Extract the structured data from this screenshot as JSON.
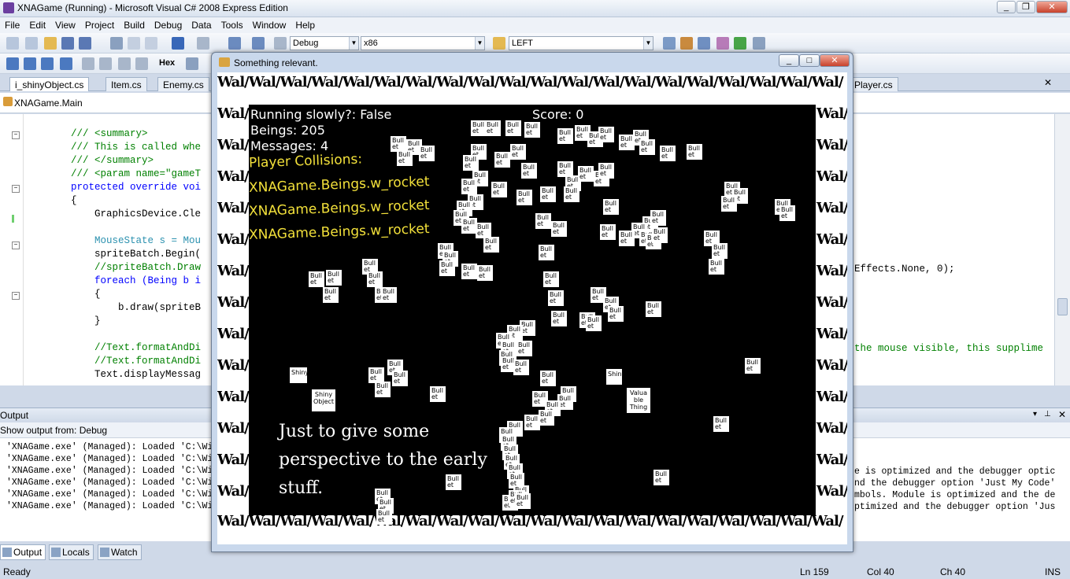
{
  "window": {
    "title": "XNAGame (Running) - Microsoft Visual C# 2008 Express Edition"
  },
  "menu": [
    "File",
    "Edit",
    "View",
    "Project",
    "Build",
    "Debug",
    "Data",
    "Tools",
    "Window",
    "Help"
  ],
  "toolbar": {
    "config": "Debug",
    "platform": "x86",
    "find": "LEFT",
    "hex": "Hex"
  },
  "tabs": [
    "i_shinyObject.cs",
    "Item.cs",
    "Enemy.cs",
    "Player.cs"
  ],
  "navbar": {
    "class": "XNAGame.Main"
  },
  "code_lines": [
    {
      "text": "        /// <summary>",
      "cls": "cm"
    },
    {
      "text": "        /// This is called whe",
      "cls": "cm"
    },
    {
      "text": "        /// </summary>",
      "cls": "cm"
    },
    {
      "text": "        /// <param name=\"gameT",
      "cls": "cm"
    },
    {
      "text": "        protected override voi",
      "cls": "kw"
    },
    {
      "text": "        {",
      "cls": ""
    },
    {
      "text": "            GraphicsDevice.Cle",
      "cls": ""
    },
    {
      "text": "",
      "cls": ""
    },
    {
      "text": "            MouseState s = Mou",
      "cls": "ty"
    },
    {
      "text": "            spriteBatch.Begin(",
      "cls": ""
    },
    {
      "text": "            //spriteBatch.Draw",
      "cls": "cm"
    },
    {
      "text": "            foreach (Being b i",
      "cls": "kw"
    },
    {
      "text": "            {",
      "cls": ""
    },
    {
      "text": "                b.draw(spriteB",
      "cls": ""
    },
    {
      "text": "            }",
      "cls": ""
    },
    {
      "text": "",
      "cls": ""
    },
    {
      "text": "            //Text.formatAndDi",
      "cls": "cm"
    },
    {
      "text": "            //Text.formatAndDi",
      "cls": "cm"
    },
    {
      "text": "            Text.displayMessag",
      "cls": ""
    }
  ],
  "code_right": [
    {
      "text": "Effects.None, 0);",
      "cls": ""
    },
    {
      "text": "the mouse visible, this supplime",
      "cls": "cm"
    }
  ],
  "output": {
    "title": "Output",
    "show_from_label": "Show output from:",
    "show_from_value": "Debug",
    "lines": [
      "'XNAGame.exe' (Managed): Loaded 'C:\\Wi",
      "'XNAGame.exe' (Managed): Loaded 'C:\\Wi",
      "'XNAGame.exe' (Managed): Loaded 'C:\\Wi",
      "'XNAGame.exe' (Managed): Loaded 'C:\\Wi",
      "'XNAGame.exe' (Managed): Loaded 'C:\\Wi",
      "'XNAGame.exe' (Managed): Loaded 'C:\\Wi"
    ],
    "right_lines": [
      "e is optimized and the debugger optic",
      "nd the debugger option 'Just My Code'",
      "mbols. Module is optimized and the de",
      "ptimized and the debugger option 'Jus"
    ]
  },
  "bottom_tabs": [
    "Output",
    "Locals",
    "Watch"
  ],
  "status": {
    "ready": "Ready",
    "ln": "Ln 159",
    "col": "Col 40",
    "ch": "Ch 40",
    "ins": "INS"
  },
  "game": {
    "title": "Something relevant.",
    "wall_text": "Wal/",
    "hud": {
      "running": "Running slowly?: False",
      "beings": "Beings: 205",
      "messages": "Messages: 4",
      "score": "Score: 0",
      "collisions": "Player Collisions:",
      "collision_items": [
        "XNAGame.Beings.w_rocket",
        "XNAGame.Beings.w_rocket",
        "XNAGame.Beings.w_rocket"
      ]
    },
    "bull_label": "Bull et",
    "shiny_small": "Shiny",
    "shiny_object": "Shiny Object",
    "valuable_thing": "Valua ble Thing",
    "note_lines": [
      "Just to give some",
      "perspective to the early",
      "stuff."
    ]
  },
  "colors": {
    "ide_bg": "#cfd9e8",
    "arena": "#000000",
    "hud_yellow": "#f2e03a"
  }
}
